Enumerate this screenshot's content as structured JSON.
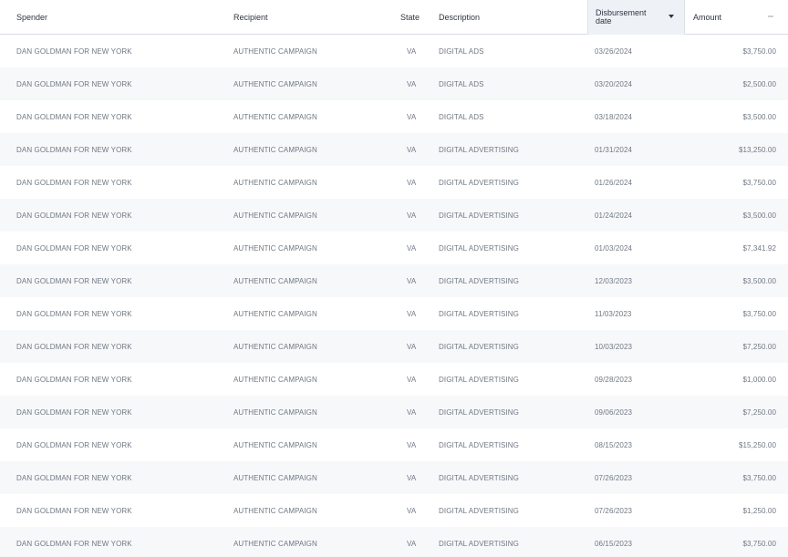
{
  "table": {
    "columns": [
      {
        "key": "spender",
        "label": "Spender"
      },
      {
        "key": "recipient",
        "label": "Recipient"
      },
      {
        "key": "state",
        "label": "State"
      },
      {
        "key": "description",
        "label": "Description"
      },
      {
        "key": "date",
        "label": "Disbursement date"
      },
      {
        "key": "amount",
        "label": "Amount"
      }
    ],
    "rows": [
      {
        "spender": "DAN GOLDMAN FOR NEW YORK",
        "recipient": "AUTHENTIC CAMPAIGN",
        "state": "VA",
        "description": "DIGITAL ADS",
        "date": "03/26/2024",
        "amount": "$3,750.00"
      },
      {
        "spender": "DAN GOLDMAN FOR NEW YORK",
        "recipient": "AUTHENTIC CAMPAIGN",
        "state": "VA",
        "description": "DIGITAL ADS",
        "date": "03/20/2024",
        "amount": "$2,500.00"
      },
      {
        "spender": "DAN GOLDMAN FOR NEW YORK",
        "recipient": "AUTHENTIC CAMPAIGN",
        "state": "VA",
        "description": "DIGITAL ADS",
        "date": "03/18/2024",
        "amount": "$3,500.00"
      },
      {
        "spender": "DAN GOLDMAN FOR NEW YORK",
        "recipient": "AUTHENTIC CAMPAIGN",
        "state": "VA",
        "description": "DIGITAL ADVERTISING",
        "date": "01/31/2024",
        "amount": "$13,250.00"
      },
      {
        "spender": "DAN GOLDMAN FOR NEW YORK",
        "recipient": "AUTHENTIC CAMPAIGN",
        "state": "VA",
        "description": "DIGITAL ADVERTISING",
        "date": "01/26/2024",
        "amount": "$3,750.00"
      },
      {
        "spender": "DAN GOLDMAN FOR NEW YORK",
        "recipient": "AUTHENTIC CAMPAIGN",
        "state": "VA",
        "description": "DIGITAL ADVERTISING",
        "date": "01/24/2024",
        "amount": "$3,500.00"
      },
      {
        "spender": "DAN GOLDMAN FOR NEW YORK",
        "recipient": "AUTHENTIC CAMPAIGN",
        "state": "VA",
        "description": "DIGITAL ADVERTISING",
        "date": "01/03/2024",
        "amount": "$7,341.92"
      },
      {
        "spender": "DAN GOLDMAN FOR NEW YORK",
        "recipient": "AUTHENTIC CAMPAIGN",
        "state": "VA",
        "description": "DIGITAL ADVERTISING",
        "date": "12/03/2023",
        "amount": "$3,500.00"
      },
      {
        "spender": "DAN GOLDMAN FOR NEW YORK",
        "recipient": "AUTHENTIC CAMPAIGN",
        "state": "VA",
        "description": "DIGITAL ADVERTISING",
        "date": "11/03/2023",
        "amount": "$3,750.00"
      },
      {
        "spender": "DAN GOLDMAN FOR NEW YORK",
        "recipient": "AUTHENTIC CAMPAIGN",
        "state": "VA",
        "description": "DIGITAL ADVERTISING",
        "date": "10/03/2023",
        "amount": "$7,250.00"
      },
      {
        "spender": "DAN GOLDMAN FOR NEW YORK",
        "recipient": "AUTHENTIC CAMPAIGN",
        "state": "VA",
        "description": "DIGITAL ADVERTISING",
        "date": "09/28/2023",
        "amount": "$1,000.00"
      },
      {
        "spender": "DAN GOLDMAN FOR NEW YORK",
        "recipient": "AUTHENTIC CAMPAIGN",
        "state": "VA",
        "description": "DIGITAL ADVERTISING",
        "date": "09/06/2023",
        "amount": "$7,250.00"
      },
      {
        "spender": "DAN GOLDMAN FOR NEW YORK",
        "recipient": "AUTHENTIC CAMPAIGN",
        "state": "VA",
        "description": "DIGITAL ADVERTISING",
        "date": "08/15/2023",
        "amount": "$15,250.00"
      },
      {
        "spender": "DAN GOLDMAN FOR NEW YORK",
        "recipient": "AUTHENTIC CAMPAIGN",
        "state": "VA",
        "description": "DIGITAL ADVERTISING",
        "date": "07/26/2023",
        "amount": "$3,750.00"
      },
      {
        "spender": "DAN GOLDMAN FOR NEW YORK",
        "recipient": "AUTHENTIC CAMPAIGN",
        "state": "VA",
        "description": "DIGITAL ADVERTISING",
        "date": "07/26/2023",
        "amount": "$1,250.00"
      },
      {
        "spender": "DAN GOLDMAN FOR NEW YORK",
        "recipient": "AUTHENTIC CAMPAIGN",
        "state": "VA",
        "description": "DIGITAL ADVERTISING",
        "date": "06/15/2023",
        "amount": "$3,750.00"
      }
    ]
  },
  "icons": {
    "sort": "sort-down-icon",
    "menu": "column-menu-icon"
  },
  "colors": {
    "header_background": "#ffffff",
    "sorted_column_background": "#eef2f7",
    "row_alt_background": "#f7f8fa",
    "header_text": "#2f3540",
    "cell_text": "#6f7883",
    "border": "#d9dde3"
  }
}
